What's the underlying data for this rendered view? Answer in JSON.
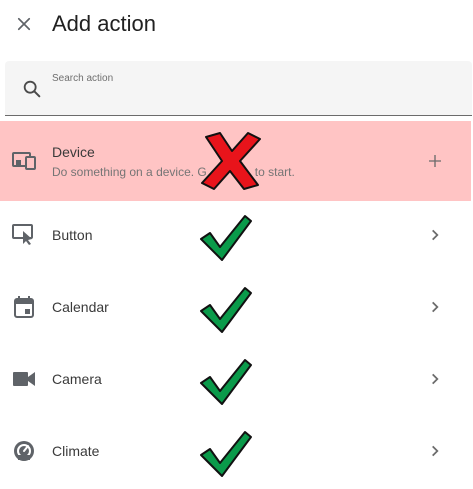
{
  "header": {
    "title": "Add action",
    "close_icon": "close-icon"
  },
  "search": {
    "placeholder": "Search action",
    "icon": "search-icon"
  },
  "items": [
    {
      "label": "Device",
      "description": "Do something on a device. Get ready to start.",
      "description_visible_left": "Do something on a device. G",
      "description_visible_right": "to start.",
      "icon": "device-icon",
      "trailing": "plus-icon",
      "highlighted": true,
      "highlight_color": "#ffc4c4",
      "annotation": "red-x-mark"
    },
    {
      "label": "Button",
      "icon": "button-press-icon",
      "trailing": "chevron-right-icon",
      "annotation": "green-check-mark"
    },
    {
      "label": "Calendar",
      "icon": "calendar-icon",
      "trailing": "chevron-right-icon",
      "annotation": "green-check-mark"
    },
    {
      "label": "Camera",
      "icon": "camera-icon",
      "trailing": "chevron-right-icon",
      "annotation": "green-check-mark"
    },
    {
      "label": "Climate",
      "icon": "climate-icon",
      "trailing": "chevron-right-icon",
      "annotation": "green-check-mark"
    }
  ],
  "colors": {
    "check_green": "#0a9a4a",
    "x_red": "#e8141b",
    "icon_gray": "#5f6368"
  }
}
